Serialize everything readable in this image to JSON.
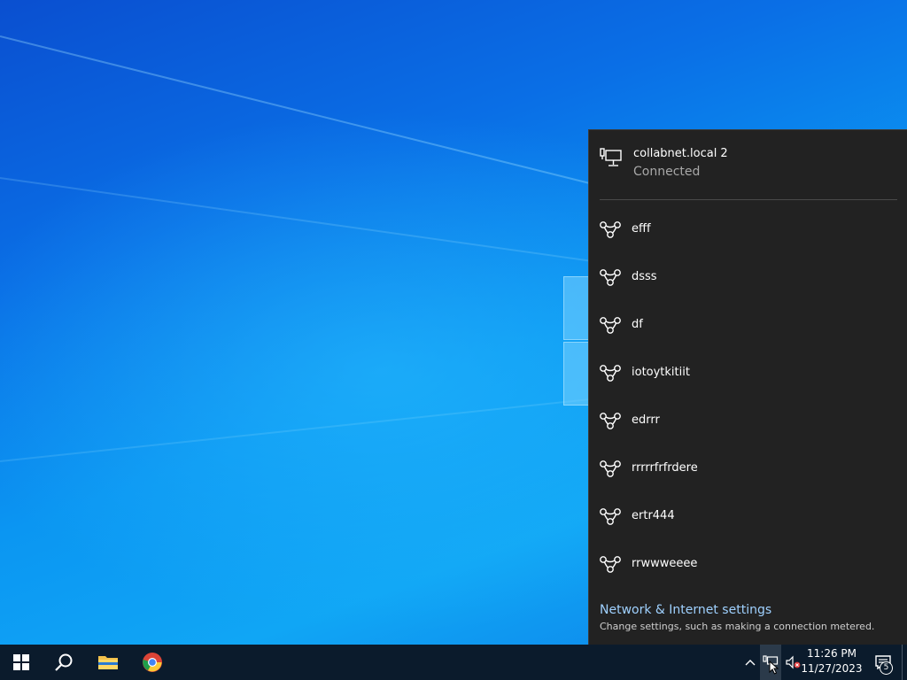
{
  "flyout": {
    "connected": {
      "name": "collabnet.local 2",
      "status": "Connected"
    },
    "networks": [
      {
        "label": "efff"
      },
      {
        "label": "dsss"
      },
      {
        "label": "df"
      },
      {
        "label": "iotoytkitiit"
      },
      {
        "label": "edrrr"
      },
      {
        "label": "rrrrrfrfrdere"
      },
      {
        "label": "ertr444"
      },
      {
        "label": "rrwwweeee"
      }
    ],
    "settings": {
      "link": "Network & Internet settings",
      "description": "Change settings, such as making a connection metered."
    }
  },
  "taskbar": {
    "apps": [
      "start-icon",
      "search-icon",
      "file-explorer-icon",
      "chrome-icon"
    ],
    "clock": {
      "time": "11:26 PM",
      "date": "11/27/2023"
    },
    "notifications_count": "5"
  },
  "colors": {
    "flyout_bg": "#222222",
    "link": "#9fd1ff",
    "taskbar_bg": "#0b1b2c"
  }
}
